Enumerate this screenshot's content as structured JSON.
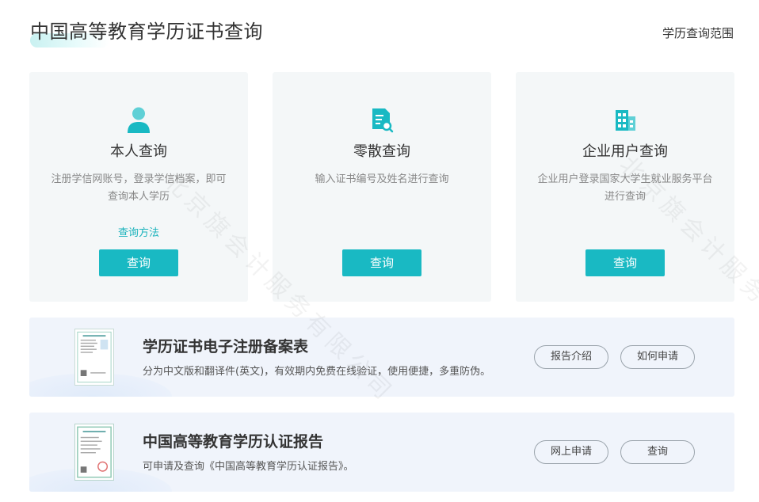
{
  "header": {
    "title": "中国高等教育学历证书查询",
    "scope_link": "学历查询范围"
  },
  "cards": [
    {
      "icon": "person-icon",
      "title": "本人查询",
      "desc": "注册学信网账号，登录学信档案，即可查询本人学历",
      "link": "查询方法",
      "button": "查询"
    },
    {
      "icon": "document-search-icon",
      "title": "零散查询",
      "desc": "输入证书编号及姓名进行查询",
      "link": "",
      "button": "查询"
    },
    {
      "icon": "building-icon",
      "title": "企业用户查询",
      "desc": "企业用户登录国家大学生就业服务平台进行查询",
      "link": "",
      "button": "查询"
    }
  ],
  "banners": [
    {
      "title": "学历证书电子注册备案表",
      "desc": "分为中文版和翻译件(英文)，有效期内免费在线验证，使用便捷，多重防伪。",
      "btn_a": "报告介绍",
      "btn_b": "如何申请"
    },
    {
      "title": "中国高等教育学历认证报告",
      "desc": "可申请及查询《中国高等教育学历认证报告》。",
      "btn_a": "网上申请",
      "btn_b": "查询"
    }
  ],
  "watermark": "北京旗会计服务有限公司",
  "watermark2": "北京旗会计服务有",
  "colors": {
    "accent": "#19b9c3",
    "link": "#1bb3bc",
    "card_bg": "#f4f7f8",
    "banner_bg": "#f0f4fb"
  }
}
